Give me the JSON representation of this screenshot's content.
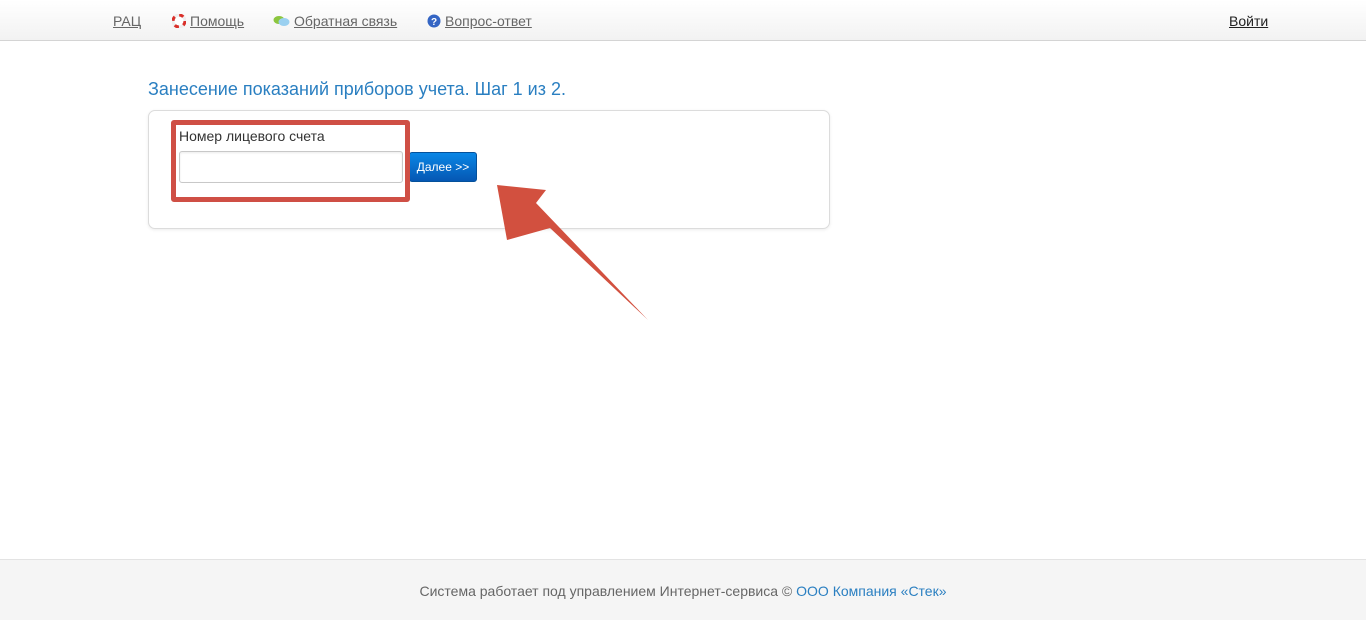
{
  "nav": {
    "items": [
      {
        "label": "РАЦ",
        "icon": null
      },
      {
        "label": "Помощь",
        "icon": "lifebuoy-icon"
      },
      {
        "label": "Обратная связь",
        "icon": "speech-bubbles-icon"
      },
      {
        "label": "Вопрос-ответ",
        "icon": "question-icon"
      }
    ],
    "login_label": "Войти"
  },
  "main": {
    "title": "Занесение показаний приборов учета. Шаг 1 из 2.",
    "form": {
      "account_label": "Номер лицевого счета",
      "account_value": "",
      "account_placeholder": "",
      "next_button_label": "Далее >>"
    }
  },
  "annotation": {
    "highlight_color": "#cf4f45"
  },
  "colors": {
    "accent": "#2a7fc1",
    "button": "#0a6fd0"
  },
  "footer": {
    "text": "Система работает под управлением Интернет-сервиса ©",
    "company_link": "ООО Компания «Стек»"
  }
}
